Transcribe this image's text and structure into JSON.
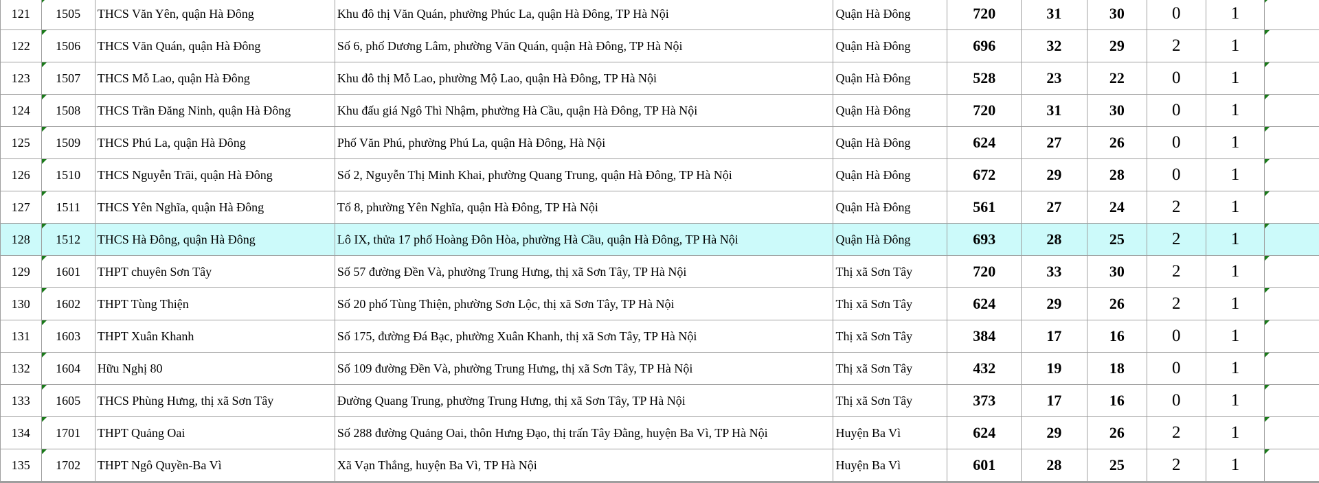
{
  "rows": [
    {
      "stt": "121",
      "code": "1505",
      "school": "THCS Văn Yên, quận Hà Đông",
      "address": "Khu đô thị Văn Quán, phường Phúc La, quận Hà Đông, TP Hà Nội",
      "district": "Quận Hà Đông",
      "total": "720",
      "c1": "31",
      "c2": "30",
      "c3": "0",
      "c4": "1",
      "selected": false
    },
    {
      "stt": "122",
      "code": "1506",
      "school": "THCS Văn Quán, quận Hà Đông",
      "address": "Số 6, phố Dương Lâm, phường Văn Quán, quận Hà Đông, TP Hà Nội",
      "district": "Quận Hà Đông",
      "total": "696",
      "c1": "32",
      "c2": "29",
      "c3": "2",
      "c4": "1",
      "selected": false
    },
    {
      "stt": "123",
      "code": "1507",
      "school": "THCS Mỗ Lao, quận Hà Đông",
      "address": "Khu đô thị Mỗ Lao, phường Mộ Lao, quận Hà Đông, TP Hà Nội",
      "district": "Quận Hà Đông",
      "total": "528",
      "c1": "23",
      "c2": "22",
      "c3": "0",
      "c4": "1",
      "selected": false
    },
    {
      "stt": "124",
      "code": "1508",
      "school": "THCS Trần Đăng Ninh, quận Hà Đông",
      "address": "Khu đấu giá Ngô Thì Nhậm, phường Hà Cầu, quận Hà Đông, TP Hà Nội",
      "district": "Quận Hà Đông",
      "total": "720",
      "c1": "31",
      "c2": "30",
      "c3": "0",
      "c4": "1",
      "selected": false
    },
    {
      "stt": "125",
      "code": "1509",
      "school": "THCS Phú La, quận Hà Đông",
      "address": "Phố Văn Phú, phường Phú La, quận Hà Đông, Hà Nội",
      "district": "Quận Hà Đông",
      "total": "624",
      "c1": "27",
      "c2": "26",
      "c3": "0",
      "c4": "1",
      "selected": false
    },
    {
      "stt": "126",
      "code": "1510",
      "school": "THCS Nguyễn Trãi, quận Hà Đông",
      "address": "Số 2, Nguyễn Thị Minh Khai, phường Quang Trung, quận Hà Đông, TP Hà Nội",
      "district": "Quận Hà Đông",
      "total": "672",
      "c1": "29",
      "c2": "28",
      "c3": "0",
      "c4": "1",
      "selected": false
    },
    {
      "stt": "127",
      "code": "1511",
      "school": "THCS Yên Nghĩa, quận Hà Đông",
      "address": "Tổ 8, phường Yên Nghĩa, quận Hà Đông, TP Hà Nội",
      "district": "Quận Hà Đông",
      "total": "561",
      "c1": "27",
      "c2": "24",
      "c3": "2",
      "c4": "1",
      "selected": false
    },
    {
      "stt": "128",
      "code": "1512",
      "school": "THCS Hà Đông, quận Hà Đông",
      "address": "Lô IX, thửa 17 phố Hoàng Đôn Hòa, phường Hà Cầu, quận Hà Đông, TP Hà Nội",
      "district": "Quận Hà Đông",
      "total": "693",
      "c1": "28",
      "c2": "25",
      "c3": "2",
      "c4": "1",
      "selected": true
    },
    {
      "stt": "129",
      "code": "1601",
      "school": "THPT chuyên Sơn Tây",
      "address": "Số 57 đường Đền Và, phường Trung Hưng, thị xã Sơn Tây, TP Hà Nội",
      "district": "Thị xã Sơn Tây",
      "total": "720",
      "c1": "33",
      "c2": "30",
      "c3": "2",
      "c4": "1",
      "selected": false
    },
    {
      "stt": "130",
      "code": "1602",
      "school": "THPT Tùng Thiện",
      "address": "Số 20 phố Tùng Thiện, phường Sơn Lộc, thị xã Sơn Tây, TP Hà Nội",
      "district": "Thị xã Sơn Tây",
      "total": "624",
      "c1": "29",
      "c2": "26",
      "c3": "2",
      "c4": "1",
      "selected": false
    },
    {
      "stt": "131",
      "code": "1603",
      "school": "THPT Xuân Khanh",
      "address": "Số 175, đường Đá Bạc, phường Xuân Khanh, thị xã Sơn Tây, TP Hà Nội",
      "district": "Thị xã Sơn Tây",
      "total": "384",
      "c1": "17",
      "c2": "16",
      "c3": "0",
      "c4": "1",
      "selected": false
    },
    {
      "stt": "132",
      "code": "1604",
      "school": "Hữu Nghị 80",
      "address": "Số 109 đường Đền Và, phường Trung Hưng, thị xã Sơn Tây, TP Hà Nội",
      "district": "Thị xã Sơn Tây",
      "total": "432",
      "c1": "19",
      "c2": "18",
      "c3": "0",
      "c4": "1",
      "selected": false
    },
    {
      "stt": "133",
      "code": "1605",
      "school": "THCS Phùng Hưng, thị xã Sơn Tây",
      "address": "Đường Quang Trung, phường Trung Hưng, thị xã Sơn Tây, TP Hà Nội",
      "district": "Thị xã Sơn Tây",
      "total": "373",
      "c1": "17",
      "c2": "16",
      "c3": "0",
      "c4": "1",
      "selected": false
    },
    {
      "stt": "134",
      "code": "1701",
      "school": "THPT Quảng Oai",
      "address": "Số 288 đường Quảng Oai, thôn Hưng Đạo, thị trấn Tây Đằng, huyện Ba Vì, TP Hà Nội",
      "district": "Huyện Ba Vì",
      "total": "624",
      "c1": "29",
      "c2": "26",
      "c3": "2",
      "c4": "1",
      "selected": false
    },
    {
      "stt": "135",
      "code": "1702",
      "school": "THPT Ngô Quyền-Ba Vì",
      "address": "Xã Vạn Thắng, huyện Ba Vì, TP Hà Nội",
      "district": "Huyện Ba Vì",
      "total": "601",
      "c1": "28",
      "c2": "25",
      "c3": "2",
      "c4": "1",
      "selected": false
    }
  ]
}
